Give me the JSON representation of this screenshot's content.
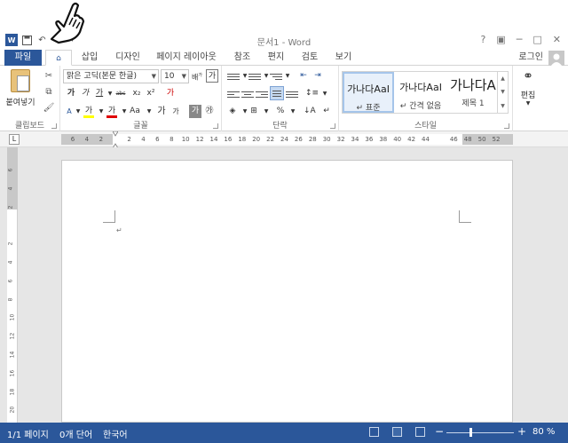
{
  "window": {
    "title": "문서1 - Word",
    "help": "?",
    "minimize": "─",
    "maximize": "□",
    "close": "✕"
  },
  "qat": {
    "app_logo": "W",
    "undo_icon": "undo-icon",
    "redo_icon": "redo-icon"
  },
  "tabs": {
    "file": "파일",
    "home_icon": "home-icon",
    "items": [
      "삽입",
      "디자인",
      "페이지 레이아웃",
      "참조",
      "편지",
      "검토",
      "보기"
    ],
    "login": "로그인"
  },
  "ribbon": {
    "clipboard": {
      "label": "클립보드",
      "paste": "붙여넣기"
    },
    "font": {
      "label": "글꼴",
      "font_name": "맑은 고딕(본문 한글)",
      "font_size": "10",
      "bold": "가",
      "italic": "가",
      "underline": "가",
      "strike": "abc",
      "subscript": "x₂",
      "superscript": "x²",
      "clear_format": "가",
      "highlight": "가",
      "font_color": "가",
      "case": "Aa",
      "grow": "가",
      "shrink": "가",
      "char_shade": "가",
      "enclose": "㉮"
    },
    "paragraph": {
      "label": "단락"
    },
    "styles": {
      "label": "스타일",
      "items": [
        {
          "sample": "가나다AaI",
          "name": "↵ 표준"
        },
        {
          "sample": "가나다AaI",
          "name": "↵ 간격 없음"
        },
        {
          "sample": "가나다A",
          "name": "제목 1"
        }
      ]
    },
    "editing": {
      "label": "편집"
    }
  },
  "ruler": {
    "selector": "L",
    "ticks": [
      "6",
      "4",
      "2",
      "",
      "2",
      "4",
      "6",
      "8",
      "10",
      "12",
      "14",
      "16",
      "18",
      "20",
      "22",
      "24",
      "26",
      "28",
      "30",
      "32",
      "34",
      "36",
      "38",
      "40",
      "42",
      "44",
      "",
      "46",
      "48",
      "50",
      "52"
    ],
    "vticks": [
      "6",
      "4",
      "2",
      "",
      "2",
      "4",
      "6",
      "8",
      "10",
      "12",
      "14",
      "16",
      "18",
      "20"
    ]
  },
  "document": {
    "paragraph_mark": "↵"
  },
  "status": {
    "page": "1/1 페이지",
    "words": "0개 단어",
    "language": "한국어",
    "zoom_minus": "−",
    "zoom_plus": "+",
    "zoom": "80 %"
  }
}
